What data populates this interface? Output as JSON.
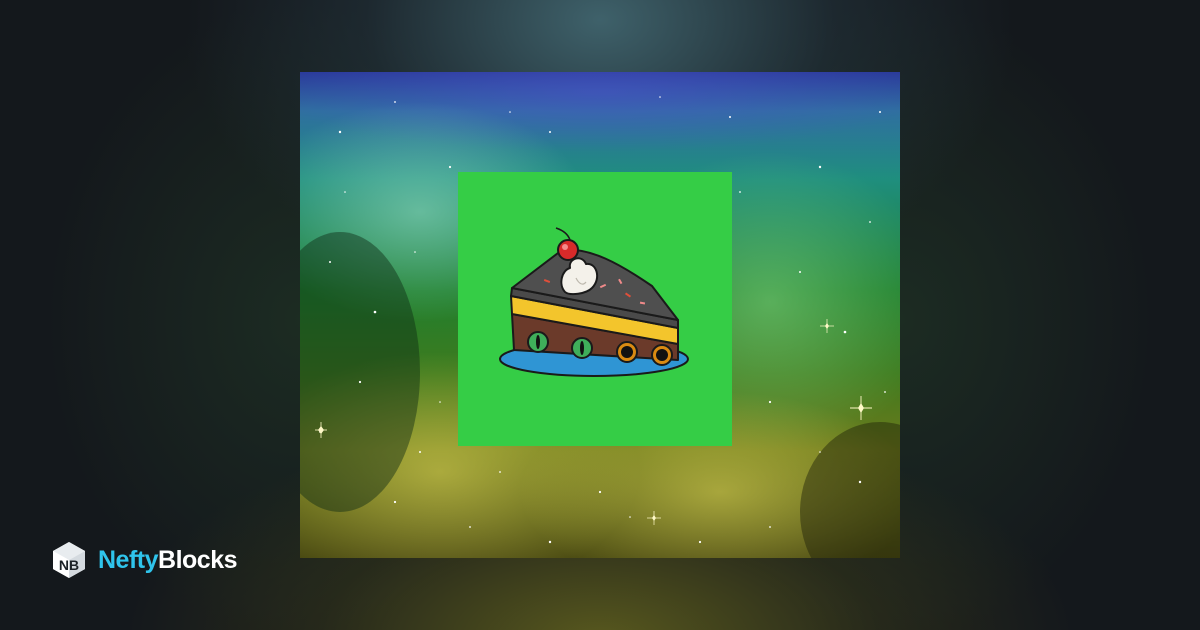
{
  "brand": {
    "name_part_1": "Nefty",
    "name_part_2": "Blocks",
    "logo_icon": "nb-cube-icon",
    "accent_color": "#2fc4ec",
    "text_color": "#ffffff"
  },
  "artwork": {
    "background": "galaxy-nebula",
    "tile_color": "#35cd46",
    "subject": "cake-slice-with-cherry-and-eyes"
  }
}
